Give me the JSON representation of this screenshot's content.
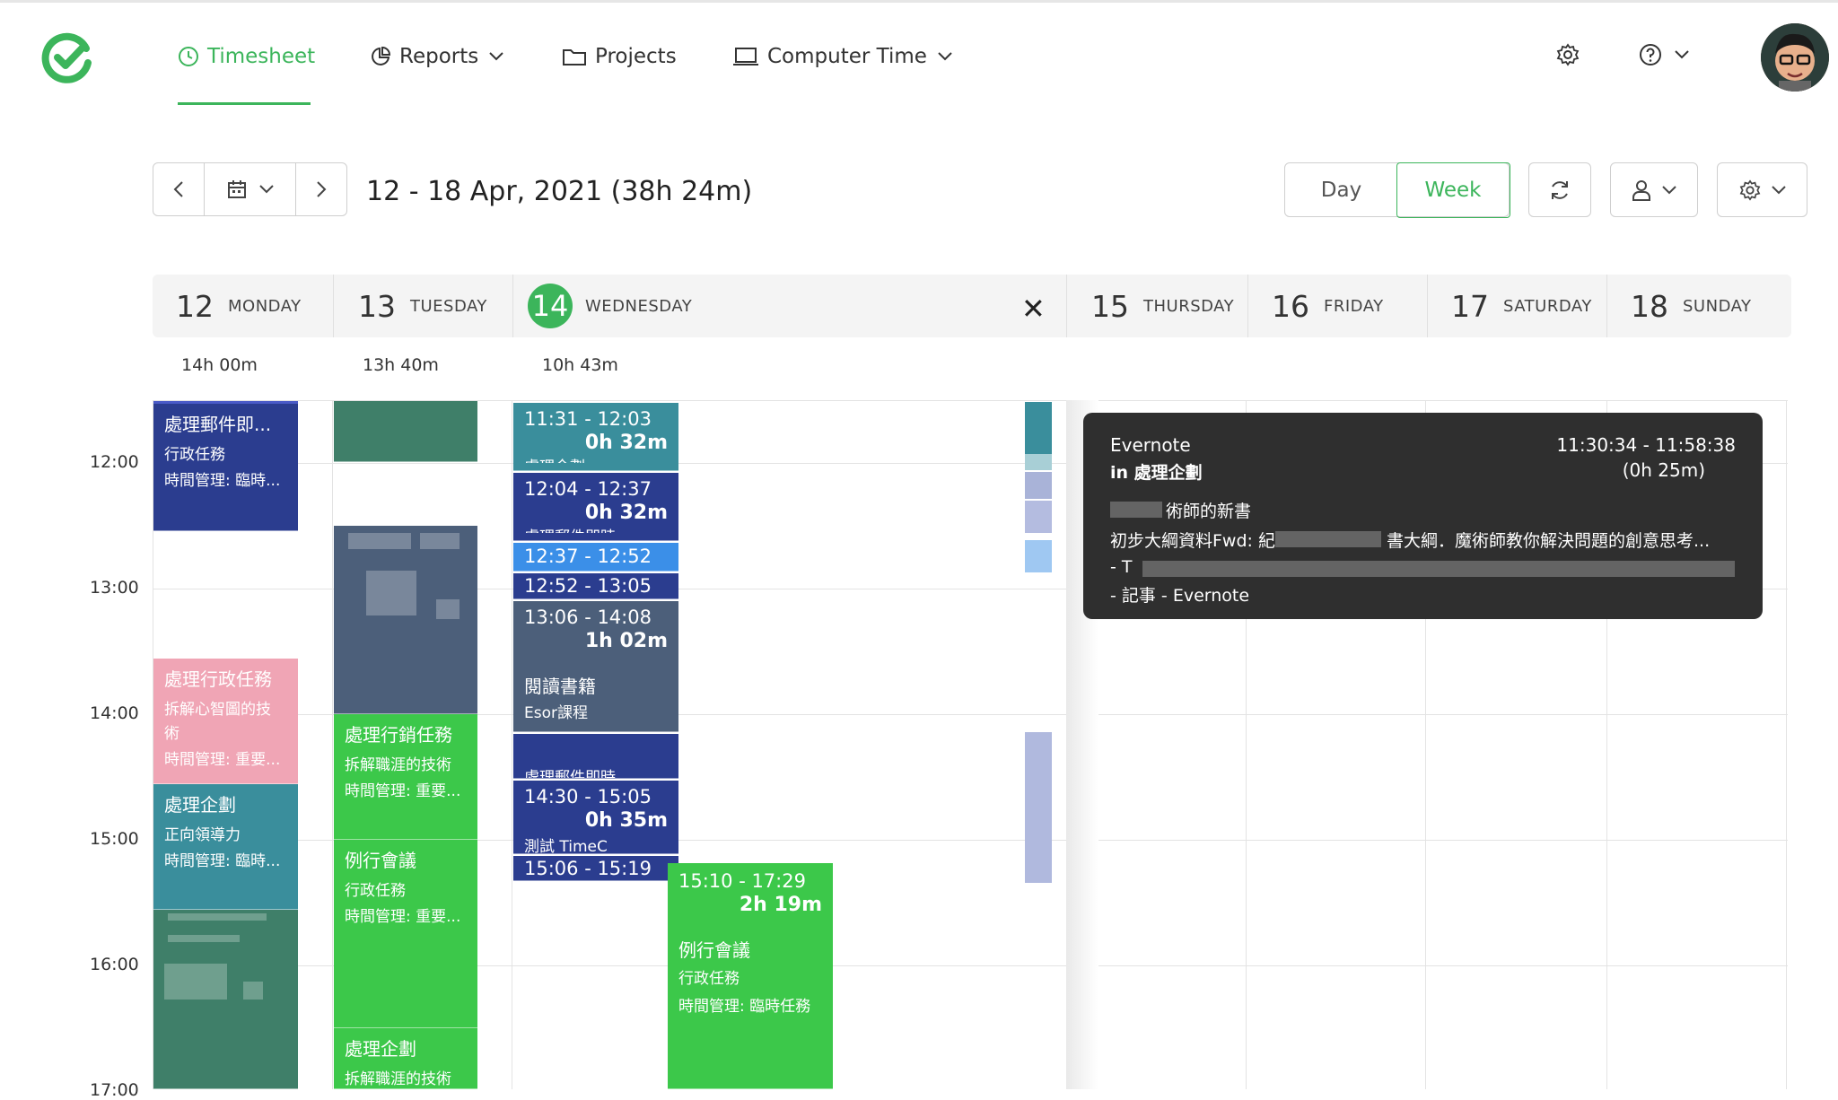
{
  "nav": {
    "timesheet": "Timesheet",
    "reports": "Reports",
    "projects": "Projects",
    "computer_time": "Computer Time"
  },
  "toolbar": {
    "range_title": "12 - 18 Apr, 2021 (38h 24m)",
    "view_day": "Day",
    "view_week": "Week"
  },
  "days": [
    {
      "num": "12",
      "name": "MONDAY",
      "total": "14h 00m"
    },
    {
      "num": "13",
      "name": "TUESDAY",
      "total": "13h 40m"
    },
    {
      "num": "14",
      "name": "WEDNESDAY",
      "total": "10h 43m"
    },
    {
      "num": "15",
      "name": "THURSDAY"
    },
    {
      "num": "16",
      "name": "FRIDAY"
    },
    {
      "num": "17",
      "name": "SATURDAY"
    },
    {
      "num": "18",
      "name": "SUNDAY"
    }
  ],
  "close_icon": "✕",
  "hours": [
    "12:00",
    "13:00",
    "14:00",
    "15:00",
    "16:00",
    "17:00"
  ],
  "events": {
    "mon_1": {
      "title": "處理郵件即...",
      "l2": "行政任務",
      "l3": "時間管理: 臨時..."
    },
    "mon_2": {
      "title": "處理行政任務",
      "l2": "拆解心智圖的技",
      "l2b": "術",
      "l3": "時間管理: 重要..."
    },
    "mon_3": {
      "title": "處理企劃",
      "l2": "正向領導力",
      "l3": "時間管理: 臨時..."
    },
    "tue_1": {
      "title": "處理行銷任務",
      "l2": "拆解職涯的技術",
      "l3": "時間管理: 重要..."
    },
    "tue_2": {
      "title": "例行會議",
      "l2": "行政任務",
      "l3": "時間管理: 重要..."
    },
    "tue_3": {
      "title": "處理企劃",
      "l2": "拆解職涯的技術"
    },
    "wed_1": {
      "time": "11:31 - 12:03",
      "dur": "0h 32m",
      "cut": "處理企劃"
    },
    "wed_2": {
      "time": "12:04 - 12:37",
      "dur": "0h 32m",
      "cut": "處理郵件即時"
    },
    "wed_3": {
      "time": "12:37 - 12:52"
    },
    "wed_4": {
      "time": "12:52 - 13:05"
    },
    "wed_5": {
      "time": "13:06 - 14:08",
      "dur": "1h 02m",
      "title": "閱讀書籍",
      "cut": "Esor課程"
    },
    "wed_6": {
      "cut": "處理郵件即時"
    },
    "wed_7": {
      "time": "14:30 - 15:05",
      "dur": "0h 35m",
      "cut": "測試 TimeC"
    },
    "wed_8": {
      "time": "15:06 - 15:19"
    },
    "wed_9": {
      "time": "15:10 - 17:29",
      "dur": "2h 19m",
      "title": "例行會議",
      "l2": "行政任務",
      "l3": "時間管理: 臨時任務"
    }
  },
  "tooltip": {
    "app": "Evernote",
    "project": "in 處理企劃",
    "time": "11:30:34 - 11:58:38",
    "dur": "(0h 25m)",
    "line1": "術師的新書",
    "line2": "初步大綱資料Fwd: 紀",
    "line2b": "書大綱．魔術師教你解決問題的創意思考...",
    "line3": "- T",
    "line4": "- 記事 - Evernote"
  },
  "colors": {
    "brand_green": "#3cb55b",
    "navy": "#2b3d8f",
    "teal": "#3a8e9c",
    "pink": "#f0a5b5",
    "green_event": "#3cc84a",
    "dark_green": "#3f7f69",
    "slate": "#4c5f7a",
    "tooltip_bg": "#2f2f2f"
  }
}
